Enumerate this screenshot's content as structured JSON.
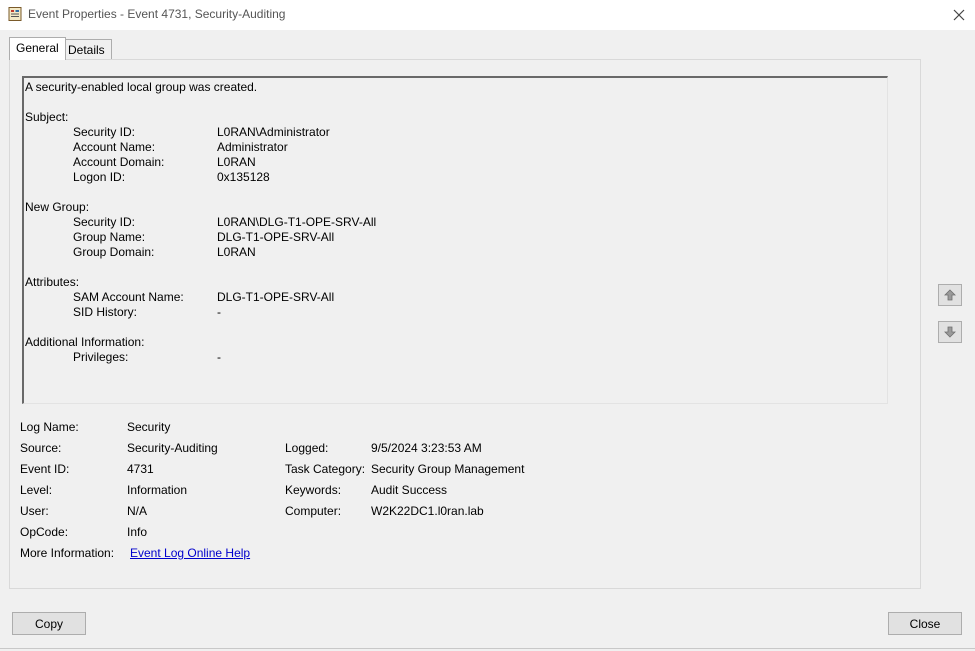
{
  "window": {
    "title": "Event Properties - Event 4731, Security-Auditing",
    "close_icon": "close-icon",
    "app_icon": "event-viewer-icon"
  },
  "tabs": [
    {
      "label": "General",
      "active": true
    },
    {
      "label": "Details",
      "active": false
    }
  ],
  "description": {
    "headline": "A security-enabled local group was created.",
    "sections": [
      {
        "title": "Subject:",
        "fields": [
          {
            "label": "Security ID:",
            "value": "L0RAN\\Administrator"
          },
          {
            "label": "Account Name:",
            "value": "Administrator"
          },
          {
            "label": "Account Domain:",
            "value": "L0RAN"
          },
          {
            "label": "Logon ID:",
            "value": "0x135128"
          }
        ]
      },
      {
        "title": "New Group:",
        "fields": [
          {
            "label": "Security ID:",
            "value": "L0RAN\\DLG-T1-OPE-SRV-All"
          },
          {
            "label": "Group Name:",
            "value": "DLG-T1-OPE-SRV-All"
          },
          {
            "label": "Group Domain:",
            "value": "L0RAN"
          }
        ]
      },
      {
        "title": "Attributes:",
        "fields": [
          {
            "label": "SAM Account Name:",
            "value": "DLG-T1-OPE-SRV-All"
          },
          {
            "label": "SID History:",
            "value": "-"
          }
        ]
      },
      {
        "title": "Additional Information:",
        "fields": [
          {
            "label": "Privileges:",
            "value": "-"
          }
        ]
      }
    ]
  },
  "properties": {
    "log_name": {
      "label": "Log Name:",
      "value": "Security"
    },
    "source": {
      "label": "Source:",
      "value": "Security-Auditing"
    },
    "logged": {
      "label": "Logged:",
      "value": "9/5/2024 3:23:53 AM"
    },
    "event_id": {
      "label": "Event ID:",
      "value": "4731"
    },
    "task_category": {
      "label": "Task Category:",
      "value": "Security Group Management"
    },
    "level": {
      "label": "Level:",
      "value": "Information"
    },
    "keywords": {
      "label": "Keywords:",
      "value": "Audit Success"
    },
    "user": {
      "label": "User:",
      "value": "N/A"
    },
    "computer": {
      "label": "Computer:",
      "value": "W2K22DC1.l0ran.lab"
    },
    "opcode": {
      "label": "OpCode:",
      "value": "Info"
    },
    "more_info": {
      "label": "More Information:",
      "link_text": "Event Log Online Help"
    }
  },
  "nav": {
    "up_icon": "arrow-up-icon",
    "down_icon": "arrow-down-icon"
  },
  "buttons": {
    "copy": "Copy",
    "close": "Close"
  }
}
